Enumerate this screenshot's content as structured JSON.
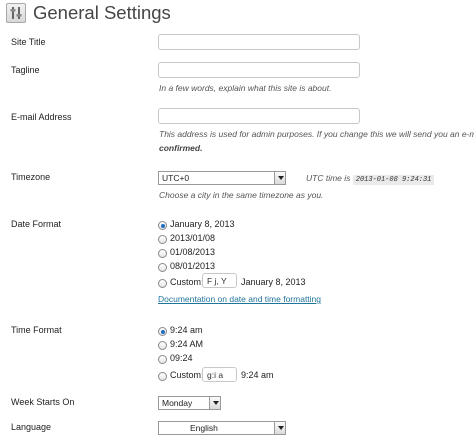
{
  "page_title": "General Settings",
  "site_title": {
    "label": "Site Title",
    "value": ""
  },
  "tagline": {
    "label": "Tagline",
    "value": "",
    "description": "In a few words, explain what this site is about."
  },
  "email": {
    "label": "E-mail Address",
    "value": "",
    "description": "This address is used for admin purposes. If you change this we will send you an e-mail",
    "description_bold": "confirmed."
  },
  "timezone": {
    "label": "Timezone",
    "selected": "UTC+0",
    "utc_prefix": "UTC time is",
    "utc_time": "2013-01-08 9:24:31",
    "help": "Choose a city in the same timezone as you."
  },
  "date_format": {
    "label": "Date Format",
    "options": [
      "January 8, 2013",
      "2013/01/08",
      "01/08/2013",
      "08/01/2013"
    ],
    "custom_label": "Custom:",
    "custom_value": "F j, Y",
    "custom_preview": "January 8, 2013",
    "doc_link": "Documentation on date and time formatting"
  },
  "time_format": {
    "label": "Time Format",
    "options": [
      "9:24 am",
      "9:24 AM",
      "09:24"
    ],
    "custom_label": "Custom:",
    "custom_value": "g:i a",
    "custom_preview": "9:24 am"
  },
  "week_starts": {
    "label": "Week Starts On",
    "selected": "Monday"
  },
  "language": {
    "label": "Language",
    "selected": "English"
  },
  "icon_names": [
    "settings-icon",
    "dropdown-arrow-icon"
  ]
}
